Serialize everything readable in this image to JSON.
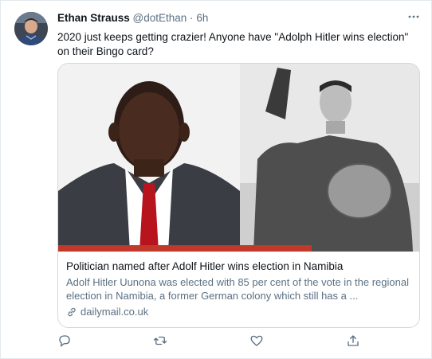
{
  "tweet": {
    "author_name": "Ethan Strauss",
    "author_handle": "@dotEthan",
    "separator": "·",
    "time": "6h",
    "text": "2020 just keeps getting crazier! Anyone have \"Adolph Hitler wins election\" on their Bingo card?"
  },
  "card": {
    "title": "Politician named after Adolf Hitler wins election in Namibia",
    "description": "Adolf Hitler Uunona was elected with 85 per cent of the vote in the regional election in Namibia, a former German colony which still has a ...",
    "domain": "dailymail.co.uk"
  },
  "icons": {
    "more": "more-horizontal-icon",
    "link": "link-icon",
    "reply": "reply-icon",
    "retweet": "retweet-icon",
    "like": "heart-icon",
    "share": "share-icon"
  },
  "colors": {
    "secondary_text": "#5b7083",
    "border": "#cfd9de",
    "card_accent": "#c0392b"
  }
}
